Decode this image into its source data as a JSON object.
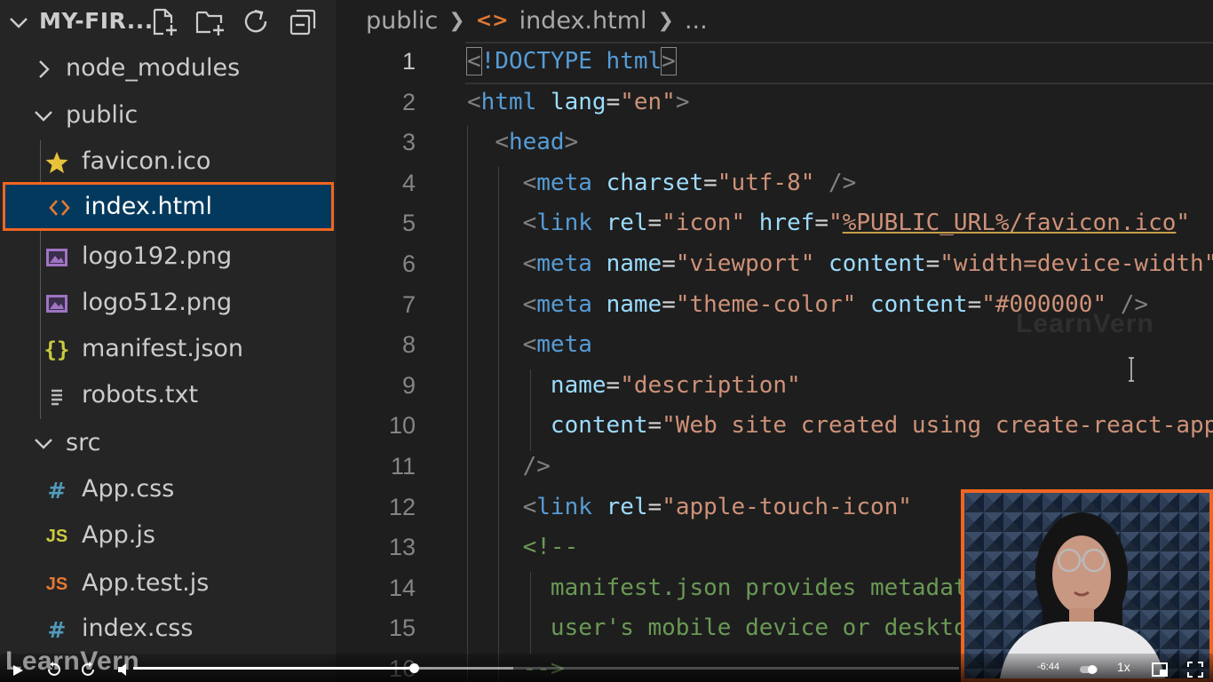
{
  "explorer": {
    "title": "MY-FIR...",
    "actions": [
      {
        "icon": "new-file-icon"
      },
      {
        "icon": "new-folder-icon"
      },
      {
        "icon": "refresh-icon"
      },
      {
        "icon": "collapse-all-icon"
      }
    ],
    "items": [
      {
        "type": "folder",
        "label": "node_modules",
        "expanded": false,
        "icon": "chevron-right-icon"
      },
      {
        "type": "folder",
        "label": "public",
        "expanded": true,
        "icon": "chevron-down-icon"
      },
      {
        "type": "file",
        "label": "favicon.ico",
        "icon": "star-icon",
        "color": "#e8c23a"
      },
      {
        "type": "file",
        "label": "index.html",
        "icon": "html-code-icon",
        "color": "#e37933",
        "selected": true
      },
      {
        "type": "file",
        "label": "logo192.png",
        "icon": "image-icon",
        "color": "#a074c4"
      },
      {
        "type": "file",
        "label": "logo512.png",
        "icon": "image-icon",
        "color": "#a074c4"
      },
      {
        "type": "file",
        "label": "manifest.json",
        "icon": "json-braces-icon",
        "color": "#cbcb41",
        "glyph": "{}"
      },
      {
        "type": "file",
        "label": "robots.txt",
        "icon": "text-lines-icon",
        "color": "#bbbbbb"
      },
      {
        "type": "folder",
        "label": "src",
        "expanded": true,
        "icon": "chevron-down-icon"
      },
      {
        "type": "file",
        "label": "App.css",
        "icon": "css-hash-icon",
        "color": "#519aba",
        "glyph": "#"
      },
      {
        "type": "file",
        "label": "App.js",
        "icon": "js-icon",
        "color": "#cbcb41",
        "glyph": "JS"
      },
      {
        "type": "file",
        "label": "App.test.js",
        "icon": "js-test-icon",
        "color": "#e37933",
        "glyph": "JS"
      },
      {
        "type": "file",
        "label": "index.css",
        "icon": "css-hash-icon",
        "color": "#519aba",
        "glyph": "#"
      }
    ]
  },
  "breadcrumb": {
    "folder": "public",
    "file": "index.html",
    "more": "..."
  },
  "code_lines": [
    {
      "n": "1",
      "tokens": [
        [
          "br",
          "<"
        ],
        [
          "tag",
          "!DOCTYPE"
        ],
        [
          "plain",
          " "
        ],
        [
          "tag",
          "html"
        ],
        [
          "br",
          ">"
        ]
      ]
    },
    {
      "n": "2",
      "tokens": [
        [
          "br",
          "<"
        ],
        [
          "tag",
          "html"
        ],
        [
          "plain",
          " "
        ],
        [
          "attr",
          "lang"
        ],
        [
          "eq",
          "="
        ],
        [
          "str",
          "\"en\""
        ],
        [
          "br",
          ">"
        ]
      ]
    },
    {
      "n": "3",
      "tokens": [
        [
          "plain",
          "  "
        ],
        [
          "br",
          "<"
        ],
        [
          "tag",
          "head"
        ],
        [
          "br",
          ">"
        ]
      ]
    },
    {
      "n": "4",
      "tokens": [
        [
          "plain",
          "    "
        ],
        [
          "br",
          "<"
        ],
        [
          "tag",
          "meta"
        ],
        [
          "plain",
          " "
        ],
        [
          "attr",
          "charset"
        ],
        [
          "eq",
          "="
        ],
        [
          "str",
          "\"utf-8\""
        ],
        [
          "plain",
          " "
        ],
        [
          "br",
          "/>"
        ]
      ]
    },
    {
      "n": "5",
      "tokens": [
        [
          "plain",
          "    "
        ],
        [
          "br",
          "<"
        ],
        [
          "tag",
          "link"
        ],
        [
          "plain",
          " "
        ],
        [
          "attr",
          "rel"
        ],
        [
          "eq",
          "="
        ],
        [
          "str",
          "\"icon\""
        ],
        [
          "plain",
          " "
        ],
        [
          "attr",
          "href"
        ],
        [
          "eq",
          "="
        ],
        [
          "str",
          "\""
        ],
        [
          "stru",
          "%PUBLIC_URL%/favicon.ico"
        ],
        [
          "str",
          "\""
        ]
      ]
    },
    {
      "n": "6",
      "tokens": [
        [
          "plain",
          "    "
        ],
        [
          "br",
          "<"
        ],
        [
          "tag",
          "meta"
        ],
        [
          "plain",
          " "
        ],
        [
          "attr",
          "name"
        ],
        [
          "eq",
          "="
        ],
        [
          "str",
          "\"viewport\""
        ],
        [
          "plain",
          " "
        ],
        [
          "attr",
          "content"
        ],
        [
          "eq",
          "="
        ],
        [
          "str",
          "\"width=device-width\""
        ]
      ]
    },
    {
      "n": "7",
      "tokens": [
        [
          "plain",
          "    "
        ],
        [
          "br",
          "<"
        ],
        [
          "tag",
          "meta"
        ],
        [
          "plain",
          " "
        ],
        [
          "attr",
          "name"
        ],
        [
          "eq",
          "="
        ],
        [
          "str",
          "\"theme-color\""
        ],
        [
          "plain",
          " "
        ],
        [
          "attr",
          "content"
        ],
        [
          "eq",
          "="
        ],
        [
          "str",
          "\"#000000\""
        ],
        [
          "plain",
          " "
        ],
        [
          "br",
          "/>"
        ]
      ]
    },
    {
      "n": "8",
      "tokens": [
        [
          "plain",
          "    "
        ],
        [
          "br",
          "<"
        ],
        [
          "tag",
          "meta"
        ]
      ]
    },
    {
      "n": "9",
      "tokens": [
        [
          "plain",
          "      "
        ],
        [
          "attr",
          "name"
        ],
        [
          "eq",
          "="
        ],
        [
          "str",
          "\"description\""
        ]
      ]
    },
    {
      "n": "10",
      "tokens": [
        [
          "plain",
          "      "
        ],
        [
          "attr",
          "content"
        ],
        [
          "eq",
          "="
        ],
        [
          "str",
          "\"Web site created using create-react-app\""
        ]
      ]
    },
    {
      "n": "11",
      "tokens": [
        [
          "plain",
          "    "
        ],
        [
          "br",
          "/>"
        ]
      ]
    },
    {
      "n": "12",
      "tokens": [
        [
          "plain",
          "    "
        ],
        [
          "br",
          "<"
        ],
        [
          "tag",
          "link"
        ],
        [
          "plain",
          " "
        ],
        [
          "attr",
          "rel"
        ],
        [
          "eq",
          "="
        ],
        [
          "str",
          "\"apple-touch-icon\""
        ]
      ]
    },
    {
      "n": "13",
      "tokens": [
        [
          "plain",
          "    "
        ],
        [
          "cm",
          "<!--"
        ]
      ]
    },
    {
      "n": "14",
      "tokens": [
        [
          "plain",
          "      "
        ],
        [
          "cm",
          "manifest.json provides metadata"
        ]
      ]
    },
    {
      "n": "15",
      "tokens": [
        [
          "plain",
          "      "
        ],
        [
          "cm",
          "user's mobile device or desktop"
        ]
      ]
    },
    {
      "n": "16",
      "tokens": [
        [
          "plain",
          "    "
        ],
        [
          "cm",
          "-->"
        ]
      ]
    }
  ],
  "watermark": "LearnVern",
  "video": {
    "brand": "LearnVern",
    "time": "-6:44",
    "speed": "1x",
    "progress": 0.34,
    "buffered": 0.46
  }
}
